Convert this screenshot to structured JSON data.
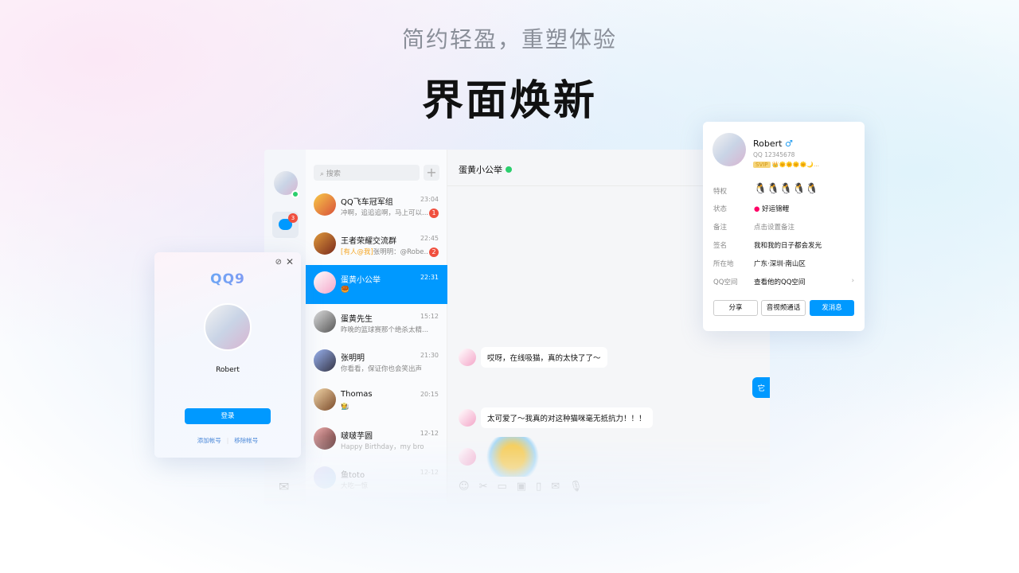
{
  "hero": {
    "subtitle": "简约轻盈，重塑体验",
    "title": "界面焕新"
  },
  "nav": {
    "unread_badge": "3"
  },
  "search": {
    "placeholder": "搜索",
    "add": "+"
  },
  "chats": [
    {
      "name": "QQ飞车冠军组",
      "time": "23:04",
      "preview": "冲啊，追追追啊，马上可以...",
      "badge": "1"
    },
    {
      "name": "王者荣耀交流群",
      "time": "22:45",
      "mention": "[有人@我]",
      "preview": "张明明：@Robe...",
      "badge": "2"
    },
    {
      "name": "蛋黄小公举",
      "time": "22:31",
      "preview": "🥮"
    },
    {
      "name": "蛋黄先生",
      "time": "15:12",
      "preview": "昨晚的篮球赛那个绝杀太精..."
    },
    {
      "name": "张明明",
      "time": "21:30",
      "preview": "你看看，保证你也会笑出声"
    },
    {
      "name": "Thomas",
      "time": "20:15",
      "preview": "🧑‍🌾"
    },
    {
      "name": "啵啵芋圆",
      "time": "12-12",
      "preview": "Happy Birthday，my bro"
    },
    {
      "name": "鱼toto",
      "time": "12-12",
      "preview": "大吃一惊"
    }
  ],
  "conversation": {
    "title": "蛋黄小公举",
    "messages": [
      "哎呀，在线吸猫，真的太快了了～",
      "它",
      "太可爱了～我真的对这种猫咪毫无抵抗力！！！"
    ]
  },
  "login": {
    "logo": "QQ9",
    "name": "Robert",
    "login_button": "登录",
    "add_account": "添加帐号",
    "remove_account": "移除帐号"
  },
  "profile": {
    "name": "Robert",
    "gender": "♂",
    "qq": "QQ 12345678",
    "vip": "SVIP",
    "rows": [
      {
        "label": "特权",
        "value": ""
      },
      {
        "label": "状态",
        "value": "好运锦鲤"
      },
      {
        "label": "备注",
        "value": "点击设置备注"
      },
      {
        "label": "签名",
        "value": "我和我的日子都会发光"
      },
      {
        "label": "所在地",
        "value": "广东·深圳·南山区"
      },
      {
        "label": "QQ空间",
        "value": "查看他的QQ空间"
      }
    ],
    "buttons": {
      "share": "分享",
      "call": "音视频通话",
      "message": "发消息"
    }
  },
  "colors": {
    "accent": "#0099ff",
    "badge": "#f04f3e",
    "online": "#2bcf6d"
  }
}
